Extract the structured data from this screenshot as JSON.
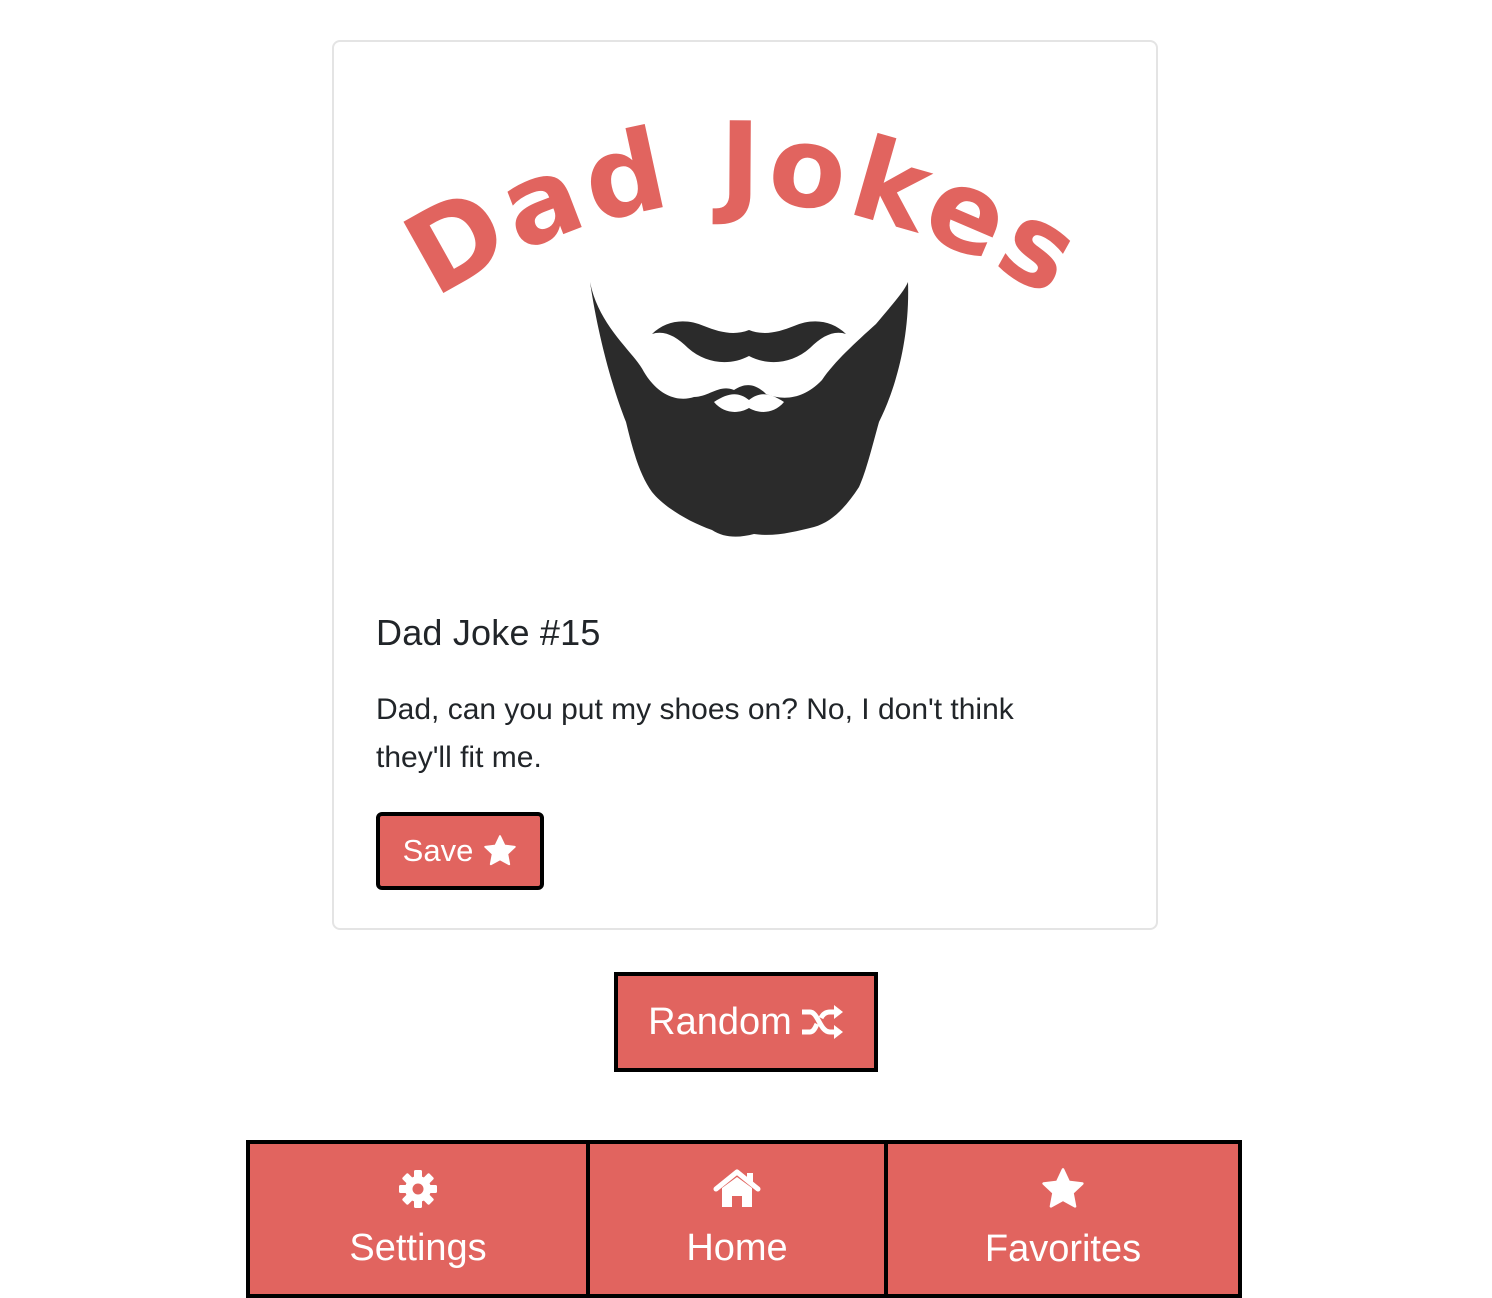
{
  "logo": {
    "text": "Dad Jokes",
    "text_color": "#e1645f",
    "beard_color": "#2b2b2b"
  },
  "joke": {
    "title": "Dad Joke #15",
    "text": "Dad, can you put my shoes on? No, I don't think they'll fit me."
  },
  "actions": {
    "save_label": "Save",
    "save_icon": "star-icon",
    "random_label": "Random",
    "random_icon": "shuffle-icon"
  },
  "nav": {
    "items": [
      {
        "label": "Settings",
        "icon": "gear-icon"
      },
      {
        "label": "Home",
        "icon": "home-icon"
      },
      {
        "label": "Favorites",
        "icon": "star-icon"
      }
    ]
  },
  "colors": {
    "accent": "#e1645f",
    "border": "#000000",
    "text": "#212529"
  }
}
